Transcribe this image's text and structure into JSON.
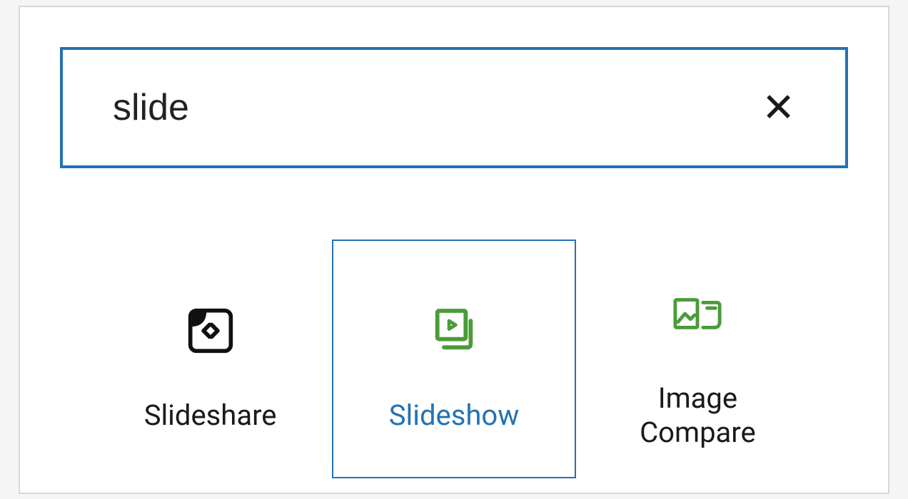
{
  "search": {
    "value": "slide",
    "clear_glyph": "✕"
  },
  "blocks": {
    "slideshare_label": "Slideshare",
    "slideshow_label": "Slideshow",
    "imagecompare_label": "Image\nCompare"
  },
  "colors": {
    "accent": "#2472b3",
    "green": "#4b9b3a",
    "text": "#1a1a1a"
  }
}
